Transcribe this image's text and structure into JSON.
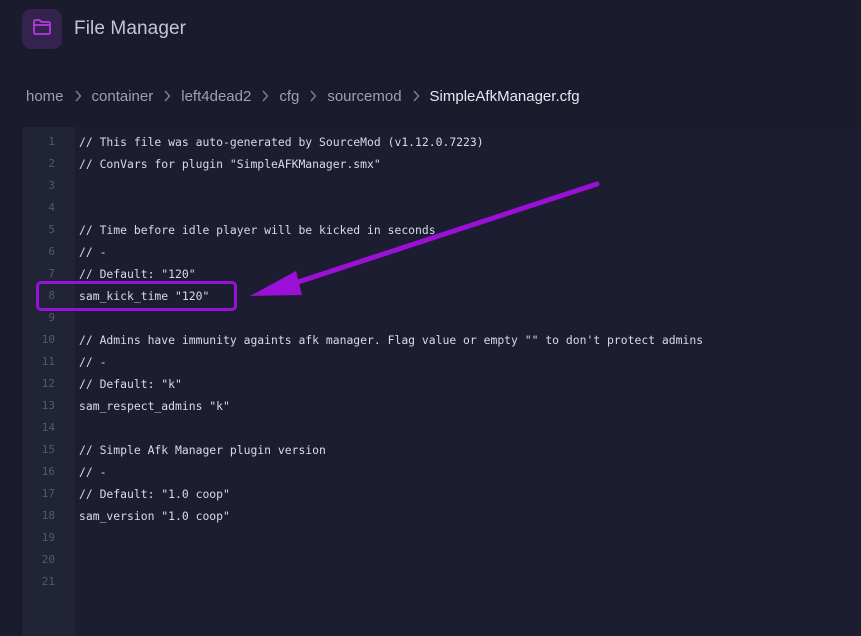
{
  "header": {
    "title": "File Manager",
    "icon": "folder-icon"
  },
  "breadcrumb": [
    "home",
    "container",
    "left4dead2",
    "cfg",
    "sourcemod",
    "SimpleAfkManager.cfg"
  ],
  "editor": {
    "lines": [
      {
        "n": "1",
        "text": "// This file was auto-generated by SourceMod (v1.12.0.7223)"
      },
      {
        "n": "2",
        "text": "// ConVars for plugin \"SimpleAFKManager.smx\""
      },
      {
        "n": "3",
        "text": ""
      },
      {
        "n": "4",
        "text": ""
      },
      {
        "n": "5",
        "text": "// Time before idle player will be kicked in seconds"
      },
      {
        "n": "6",
        "text": "// -"
      },
      {
        "n": "7",
        "text": "// Default: \"120\""
      },
      {
        "n": "8",
        "text": "sam_kick_time \"120\""
      },
      {
        "n": "9",
        "text": ""
      },
      {
        "n": "10",
        "text": "// Admins have immunity againts afk manager. Flag value or empty \"\" to don't protect admins"
      },
      {
        "n": "11",
        "text": "// -"
      },
      {
        "n": "12",
        "text": "// Default: \"k\""
      },
      {
        "n": "13",
        "text": "sam_respect_admins \"k\""
      },
      {
        "n": "14",
        "text": ""
      },
      {
        "n": "15",
        "text": "// Simple Afk Manager plugin version"
      },
      {
        "n": "16",
        "text": "// -"
      },
      {
        "n": "17",
        "text": "// Default: \"1.0 coop\""
      },
      {
        "n": "18",
        "text": "sam_version \"1.0 coop\""
      },
      {
        "n": "19",
        "text": ""
      },
      {
        "n": "20",
        "text": ""
      },
      {
        "n": "21",
        "text": ""
      }
    ]
  },
  "colors": {
    "background": "#1a1b2d",
    "accent": "#9b10d6",
    "icon_bg": "#34234f"
  }
}
